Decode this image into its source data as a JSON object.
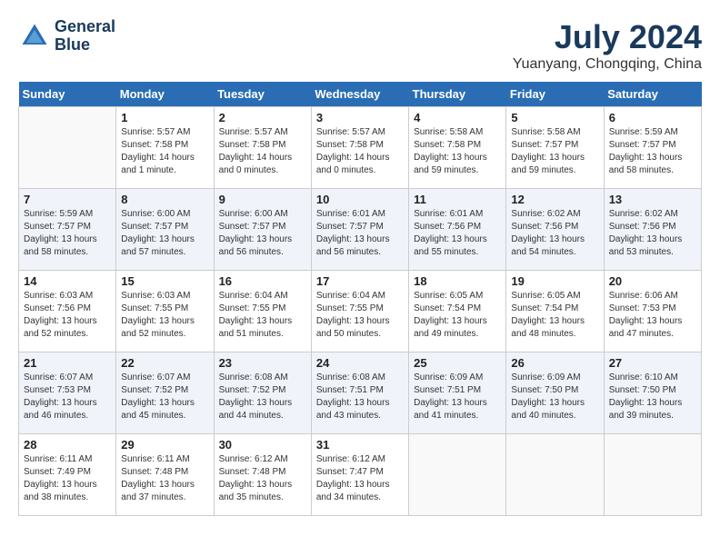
{
  "header": {
    "logo_line1": "General",
    "logo_line2": "Blue",
    "month_year": "July 2024",
    "location": "Yuanyang, Chongqing, China"
  },
  "columns": [
    "Sunday",
    "Monday",
    "Tuesday",
    "Wednesday",
    "Thursday",
    "Friday",
    "Saturday"
  ],
  "weeks": [
    [
      {
        "day": "",
        "sunrise": "",
        "sunset": "",
        "daylight": ""
      },
      {
        "day": "1",
        "sunrise": "Sunrise: 5:57 AM",
        "sunset": "Sunset: 7:58 PM",
        "daylight": "Daylight: 14 hours and 1 minute."
      },
      {
        "day": "2",
        "sunrise": "Sunrise: 5:57 AM",
        "sunset": "Sunset: 7:58 PM",
        "daylight": "Daylight: 14 hours and 0 minutes."
      },
      {
        "day": "3",
        "sunrise": "Sunrise: 5:57 AM",
        "sunset": "Sunset: 7:58 PM",
        "daylight": "Daylight: 14 hours and 0 minutes."
      },
      {
        "day": "4",
        "sunrise": "Sunrise: 5:58 AM",
        "sunset": "Sunset: 7:58 PM",
        "daylight": "Daylight: 13 hours and 59 minutes."
      },
      {
        "day": "5",
        "sunrise": "Sunrise: 5:58 AM",
        "sunset": "Sunset: 7:57 PM",
        "daylight": "Daylight: 13 hours and 59 minutes."
      },
      {
        "day": "6",
        "sunrise": "Sunrise: 5:59 AM",
        "sunset": "Sunset: 7:57 PM",
        "daylight": "Daylight: 13 hours and 58 minutes."
      }
    ],
    [
      {
        "day": "7",
        "sunrise": "Sunrise: 5:59 AM",
        "sunset": "Sunset: 7:57 PM",
        "daylight": "Daylight: 13 hours and 58 minutes."
      },
      {
        "day": "8",
        "sunrise": "Sunrise: 6:00 AM",
        "sunset": "Sunset: 7:57 PM",
        "daylight": "Daylight: 13 hours and 57 minutes."
      },
      {
        "day": "9",
        "sunrise": "Sunrise: 6:00 AM",
        "sunset": "Sunset: 7:57 PM",
        "daylight": "Daylight: 13 hours and 56 minutes."
      },
      {
        "day": "10",
        "sunrise": "Sunrise: 6:01 AM",
        "sunset": "Sunset: 7:57 PM",
        "daylight": "Daylight: 13 hours and 56 minutes."
      },
      {
        "day": "11",
        "sunrise": "Sunrise: 6:01 AM",
        "sunset": "Sunset: 7:56 PM",
        "daylight": "Daylight: 13 hours and 55 minutes."
      },
      {
        "day": "12",
        "sunrise": "Sunrise: 6:02 AM",
        "sunset": "Sunset: 7:56 PM",
        "daylight": "Daylight: 13 hours and 54 minutes."
      },
      {
        "day": "13",
        "sunrise": "Sunrise: 6:02 AM",
        "sunset": "Sunset: 7:56 PM",
        "daylight": "Daylight: 13 hours and 53 minutes."
      }
    ],
    [
      {
        "day": "14",
        "sunrise": "Sunrise: 6:03 AM",
        "sunset": "Sunset: 7:56 PM",
        "daylight": "Daylight: 13 hours and 52 minutes."
      },
      {
        "day": "15",
        "sunrise": "Sunrise: 6:03 AM",
        "sunset": "Sunset: 7:55 PM",
        "daylight": "Daylight: 13 hours and 52 minutes."
      },
      {
        "day": "16",
        "sunrise": "Sunrise: 6:04 AM",
        "sunset": "Sunset: 7:55 PM",
        "daylight": "Daylight: 13 hours and 51 minutes."
      },
      {
        "day": "17",
        "sunrise": "Sunrise: 6:04 AM",
        "sunset": "Sunset: 7:55 PM",
        "daylight": "Daylight: 13 hours and 50 minutes."
      },
      {
        "day": "18",
        "sunrise": "Sunrise: 6:05 AM",
        "sunset": "Sunset: 7:54 PM",
        "daylight": "Daylight: 13 hours and 49 minutes."
      },
      {
        "day": "19",
        "sunrise": "Sunrise: 6:05 AM",
        "sunset": "Sunset: 7:54 PM",
        "daylight": "Daylight: 13 hours and 48 minutes."
      },
      {
        "day": "20",
        "sunrise": "Sunrise: 6:06 AM",
        "sunset": "Sunset: 7:53 PM",
        "daylight": "Daylight: 13 hours and 47 minutes."
      }
    ],
    [
      {
        "day": "21",
        "sunrise": "Sunrise: 6:07 AM",
        "sunset": "Sunset: 7:53 PM",
        "daylight": "Daylight: 13 hours and 46 minutes."
      },
      {
        "day": "22",
        "sunrise": "Sunrise: 6:07 AM",
        "sunset": "Sunset: 7:52 PM",
        "daylight": "Daylight: 13 hours and 45 minutes."
      },
      {
        "day": "23",
        "sunrise": "Sunrise: 6:08 AM",
        "sunset": "Sunset: 7:52 PM",
        "daylight": "Daylight: 13 hours and 44 minutes."
      },
      {
        "day": "24",
        "sunrise": "Sunrise: 6:08 AM",
        "sunset": "Sunset: 7:51 PM",
        "daylight": "Daylight: 13 hours and 43 minutes."
      },
      {
        "day": "25",
        "sunrise": "Sunrise: 6:09 AM",
        "sunset": "Sunset: 7:51 PM",
        "daylight": "Daylight: 13 hours and 41 minutes."
      },
      {
        "day": "26",
        "sunrise": "Sunrise: 6:09 AM",
        "sunset": "Sunset: 7:50 PM",
        "daylight": "Daylight: 13 hours and 40 minutes."
      },
      {
        "day": "27",
        "sunrise": "Sunrise: 6:10 AM",
        "sunset": "Sunset: 7:50 PM",
        "daylight": "Daylight: 13 hours and 39 minutes."
      }
    ],
    [
      {
        "day": "28",
        "sunrise": "Sunrise: 6:11 AM",
        "sunset": "Sunset: 7:49 PM",
        "daylight": "Daylight: 13 hours and 38 minutes."
      },
      {
        "day": "29",
        "sunrise": "Sunrise: 6:11 AM",
        "sunset": "Sunset: 7:48 PM",
        "daylight": "Daylight: 13 hours and 37 minutes."
      },
      {
        "day": "30",
        "sunrise": "Sunrise: 6:12 AM",
        "sunset": "Sunset: 7:48 PM",
        "daylight": "Daylight: 13 hours and 35 minutes."
      },
      {
        "day": "31",
        "sunrise": "Sunrise: 6:12 AM",
        "sunset": "Sunset: 7:47 PM",
        "daylight": "Daylight: 13 hours and 34 minutes."
      },
      {
        "day": "",
        "sunrise": "",
        "sunset": "",
        "daylight": ""
      },
      {
        "day": "",
        "sunrise": "",
        "sunset": "",
        "daylight": ""
      },
      {
        "day": "",
        "sunrise": "",
        "sunset": "",
        "daylight": ""
      }
    ]
  ]
}
